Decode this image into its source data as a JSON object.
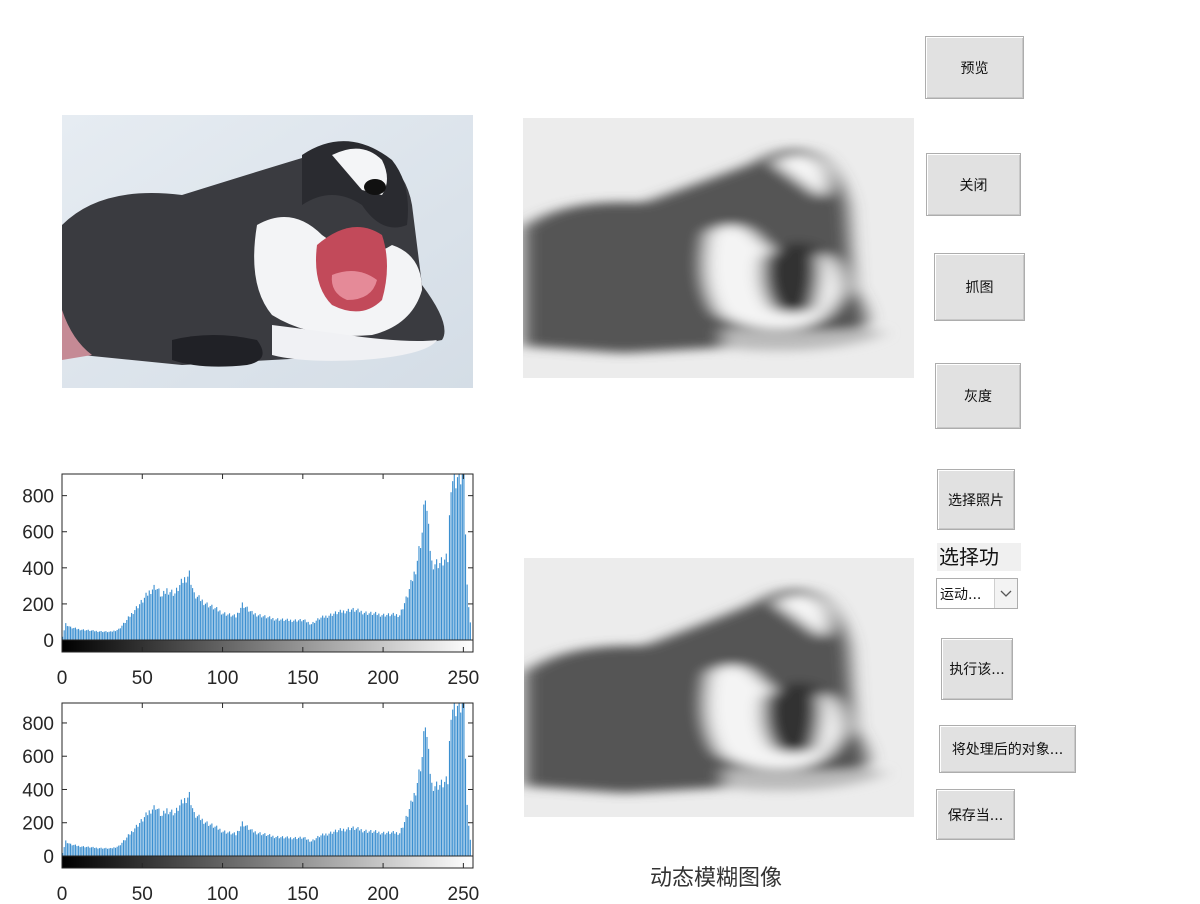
{
  "buttons": {
    "preview": "预览",
    "close": "关闭",
    "capture": "抓图",
    "gray": "灰度",
    "choose_photo": "选择照片",
    "execute": "执行该...",
    "send_processed": "将处理后的对象...",
    "save_current": "保存当..."
  },
  "select_label": "选择功",
  "function_dropdown": {
    "value": "运动..."
  },
  "caption_motion_blur": "动态模糊图像",
  "icons": {
    "dropdown_arrow": "chevron-down-icon"
  },
  "colors": {
    "histogram_bar": "#3b8fd0",
    "button_face": "#e1e1e1",
    "axes_border": "#262626"
  },
  "chart_data": [
    {
      "type": "bar",
      "x_ticks": [
        0,
        50,
        100,
        150,
        200,
        250
      ],
      "y_ticks": [
        0,
        200,
        400,
        600,
        800
      ],
      "xlim": [
        0,
        256
      ],
      "ylim": [
        0,
        920
      ],
      "colorbar": "gray",
      "profile": [
        [
          0,
          20
        ],
        [
          2,
          90
        ],
        [
          5,
          70
        ],
        [
          10,
          60
        ],
        [
          20,
          50
        ],
        [
          30,
          45
        ],
        [
          35,
          60
        ],
        [
          40,
          110
        ],
        [
          45,
          170
        ],
        [
          50,
          220
        ],
        [
          55,
          280
        ],
        [
          58,
          300
        ],
        [
          62,
          240
        ],
        [
          65,
          280
        ],
        [
          70,
          260
        ],
        [
          75,
          330
        ],
        [
          79,
          370
        ],
        [
          82,
          250
        ],
        [
          90,
          200
        ],
        [
          100,
          150
        ],
        [
          108,
          130
        ],
        [
          112,
          200
        ],
        [
          118,
          150
        ],
        [
          130,
          120
        ],
        [
          140,
          110
        ],
        [
          150,
          110
        ],
        [
          155,
          90
        ],
        [
          160,
          120
        ],
        [
          170,
          150
        ],
        [
          180,
          170
        ],
        [
          190,
          150
        ],
        [
          200,
          140
        ],
        [
          210,
          140
        ],
        [
          215,
          250
        ],
        [
          220,
          400
        ],
        [
          224,
          600
        ],
        [
          226,
          820
        ],
        [
          228,
          600
        ],
        [
          230,
          430
        ],
        [
          235,
          430
        ],
        [
          240,
          450
        ],
        [
          242,
          900
        ],
        [
          250,
          920
        ],
        [
          252,
          300
        ],
        [
          255,
          0
        ]
      ]
    },
    {
      "type": "bar",
      "x_ticks": [
        0,
        50,
        100,
        150,
        200,
        250
      ],
      "y_ticks": [
        0,
        200,
        400,
        600,
        800
      ],
      "xlim": [
        0,
        256
      ],
      "ylim": [
        0,
        920
      ],
      "colorbar": "gray",
      "profile": [
        [
          0,
          20
        ],
        [
          2,
          90
        ],
        [
          5,
          70
        ],
        [
          10,
          60
        ],
        [
          20,
          50
        ],
        [
          30,
          45
        ],
        [
          35,
          60
        ],
        [
          40,
          110
        ],
        [
          45,
          170
        ],
        [
          50,
          220
        ],
        [
          55,
          280
        ],
        [
          58,
          300
        ],
        [
          62,
          240
        ],
        [
          65,
          280
        ],
        [
          70,
          260
        ],
        [
          75,
          330
        ],
        [
          79,
          370
        ],
        [
          82,
          250
        ],
        [
          90,
          200
        ],
        [
          100,
          150
        ],
        [
          108,
          130
        ],
        [
          112,
          200
        ],
        [
          118,
          150
        ],
        [
          130,
          120
        ],
        [
          140,
          110
        ],
        [
          150,
          110
        ],
        [
          155,
          90
        ],
        [
          160,
          120
        ],
        [
          170,
          150
        ],
        [
          180,
          170
        ],
        [
          190,
          150
        ],
        [
          200,
          140
        ],
        [
          210,
          140
        ],
        [
          215,
          250
        ],
        [
          220,
          400
        ],
        [
          224,
          600
        ],
        [
          226,
          820
        ],
        [
          228,
          600
        ],
        [
          230,
          430
        ],
        [
          235,
          430
        ],
        [
          240,
          450
        ],
        [
          242,
          900
        ],
        [
          250,
          920
        ],
        [
          252,
          300
        ],
        [
          255,
          0
        ]
      ]
    }
  ]
}
